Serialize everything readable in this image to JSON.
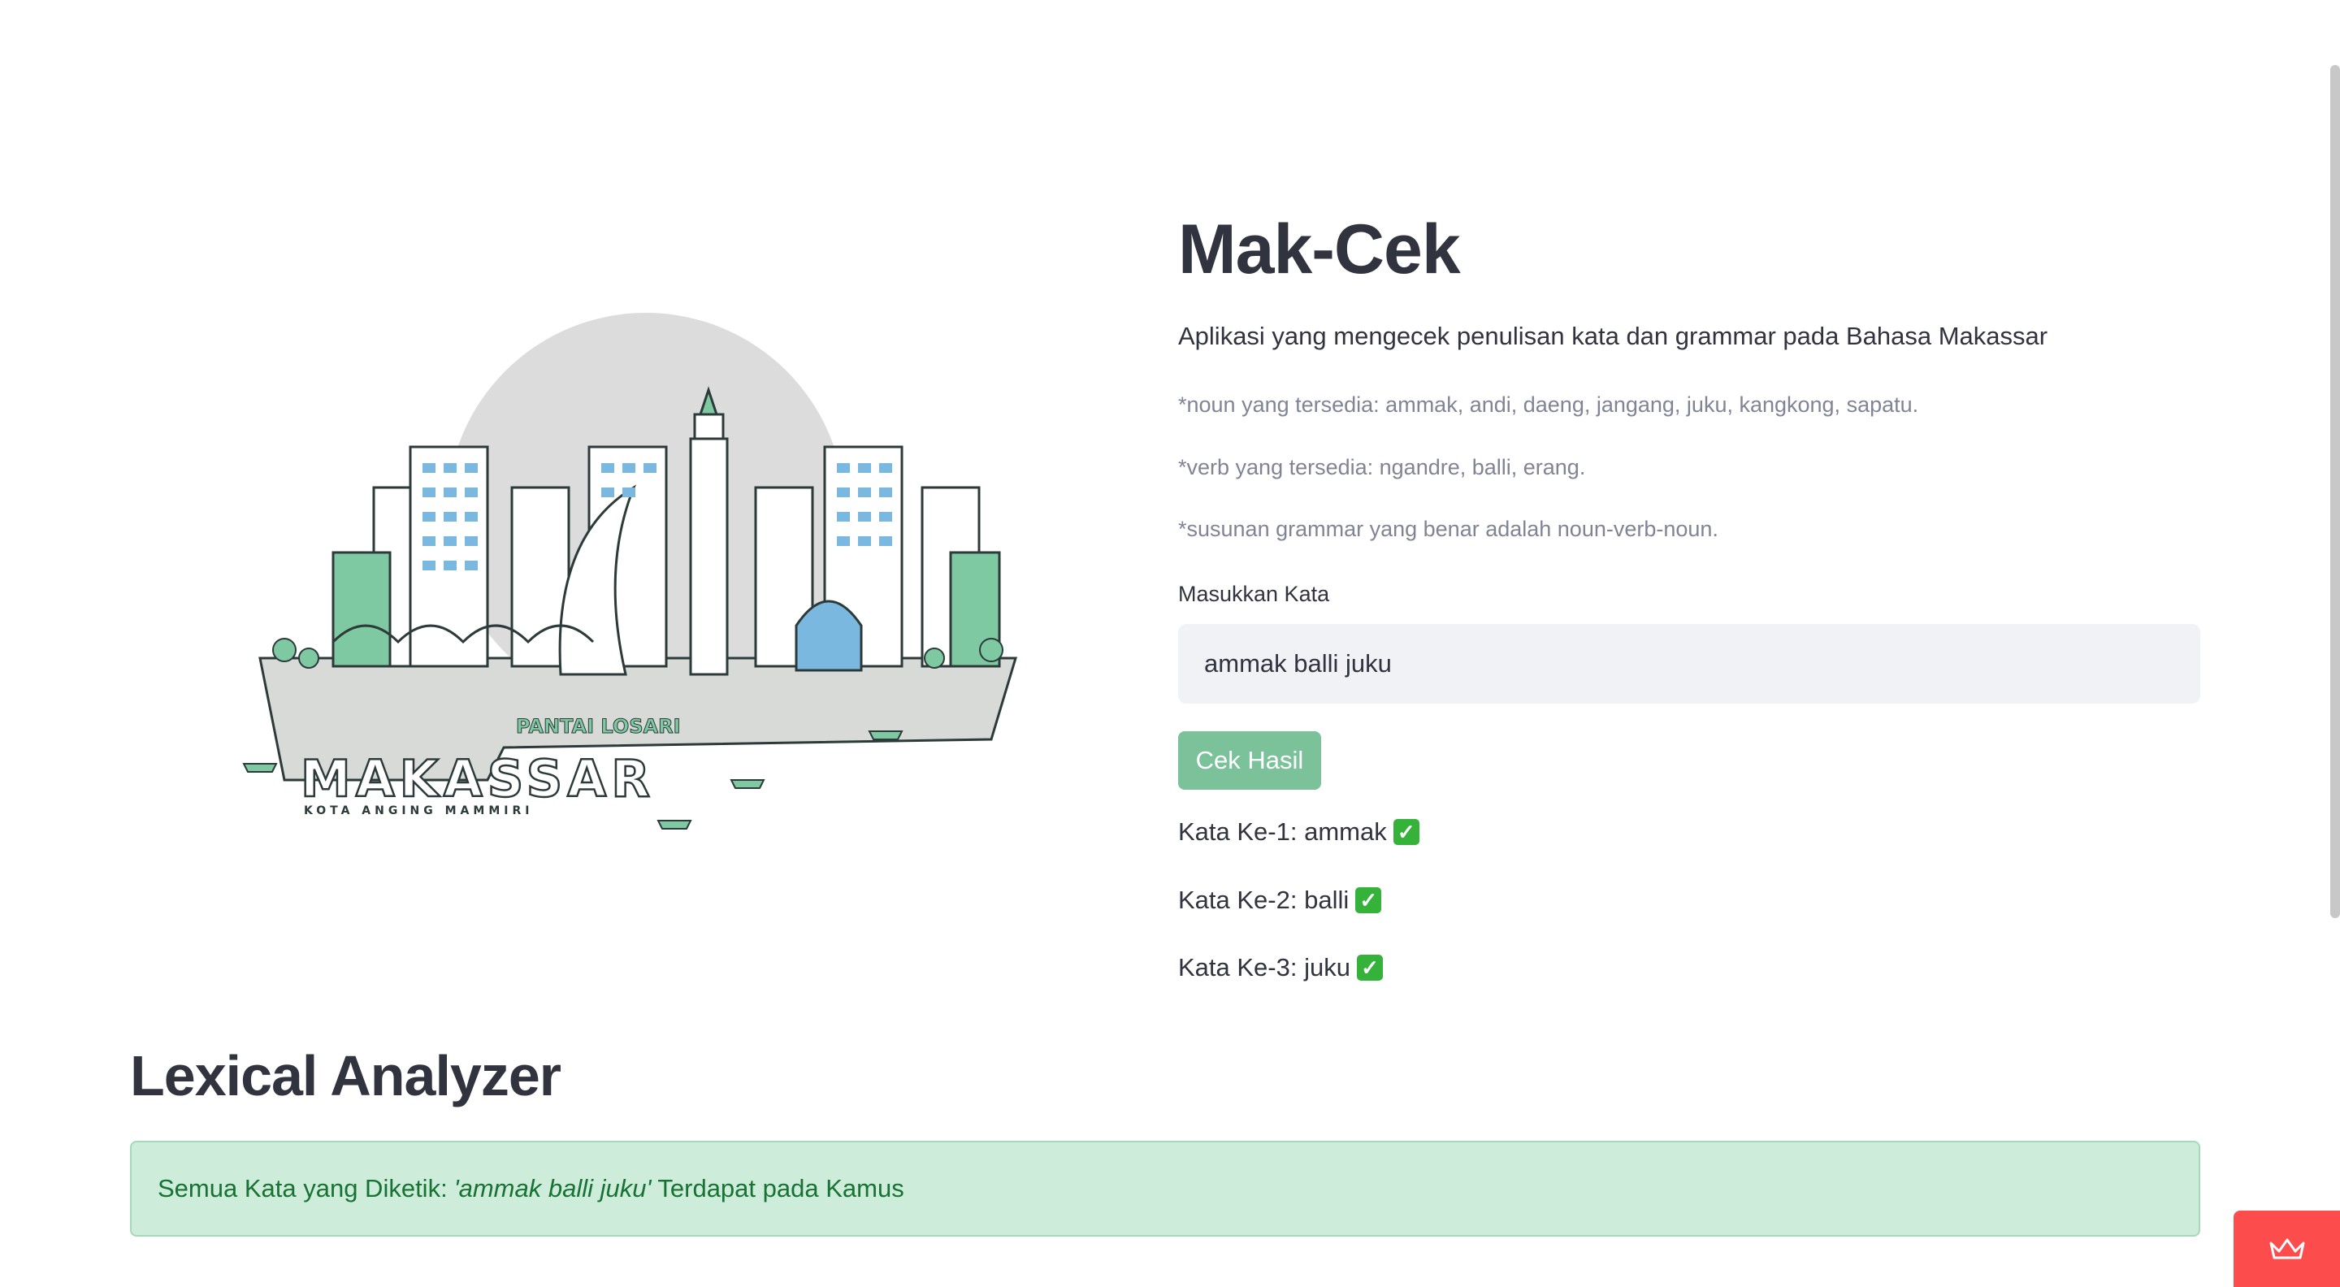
{
  "app": {
    "title": "Mak-Cek",
    "subtitle": "Aplikasi yang mengecek penulisan kata dan grammar pada Bahasa Makassar"
  },
  "notes": {
    "noun": "*noun yang tersedia: ammak, andi, daeng, jangang, juku, kangkong, sapatu.",
    "verb": "*verb yang tersedia: ngandre, balli, erang.",
    "grammar": "*susunan grammar yang benar adalah noun-verb-noun."
  },
  "input": {
    "label": "Masukkan Kata",
    "value": "ammak balli juku"
  },
  "button": {
    "label": "Cek Hasil"
  },
  "results": [
    {
      "text": "Kata Ke-1: ammak"
    },
    {
      "text": "Kata Ke-2: balli"
    },
    {
      "text": "Kata Ke-3: juku"
    }
  ],
  "illustration": {
    "city": "MAKASSAR",
    "tagline": "KOTA ANGING MAMMIRI",
    "sign": "PANTAI LOSARI"
  },
  "lexical": {
    "heading": "Lexical Analyzer",
    "prefix": "Semua Kata yang Diketik:",
    "quoted": "'ammak balli juku'",
    "suffix": "Terdapat pada Kamus"
  },
  "colors": {
    "button": "#7bc29b",
    "alert_bg": "#cdecda",
    "alert_text": "#177233",
    "check": "#35b23a",
    "badge": "#fc4c4c"
  }
}
